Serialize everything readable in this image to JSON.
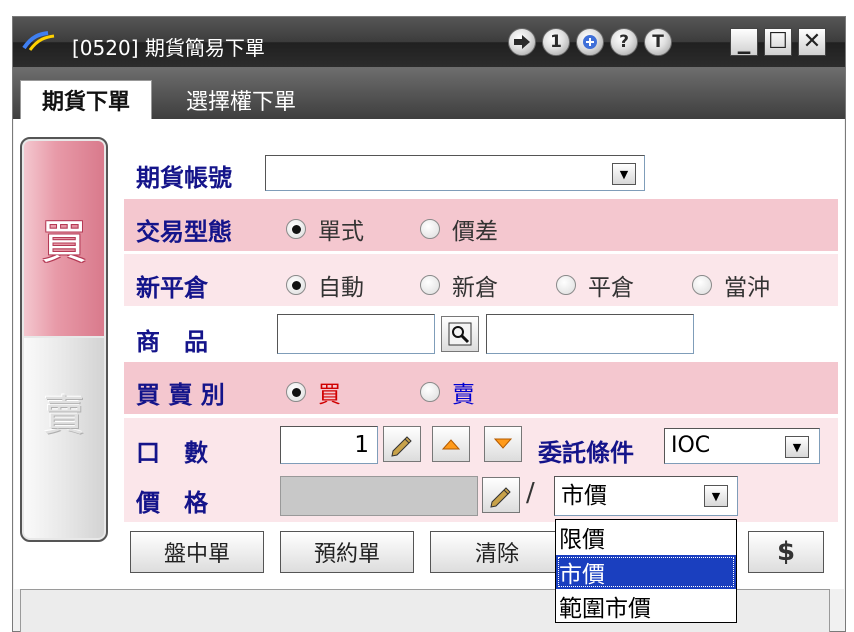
{
  "window": {
    "title": "[0520] 期貨簡易下單",
    "toolbar_icons": [
      "forward-icon",
      "one-icon",
      "settings-icon",
      "help-icon",
      "t-icon"
    ],
    "toolbar_labels": [
      "1",
      "?",
      "T"
    ],
    "minimize": "▁",
    "maximize": "☐",
    "close": "✕"
  },
  "tabs": [
    {
      "label": "期貨下單",
      "active": true
    },
    {
      "label": "選擇權下單",
      "active": false
    }
  ],
  "side": {
    "buy": "買",
    "sell": "賣",
    "selected": "buy"
  },
  "form": {
    "account": {
      "label": "期貨帳號",
      "value": ""
    },
    "trade_type": {
      "label": "交易型態",
      "options": [
        "單式",
        "價差"
      ],
      "selected": 0
    },
    "open_close": {
      "label": "新平倉",
      "options": [
        "自動",
        "新倉",
        "平倉",
        "當沖"
      ],
      "selected": 0
    },
    "product": {
      "label": "商　品",
      "code": "",
      "name": ""
    },
    "bs": {
      "label": "買 賣 別",
      "options": [
        "買",
        "賣"
      ],
      "selected": 0,
      "colors": [
        "#d00000",
        "#0000d0"
      ]
    },
    "qty": {
      "label": "口　數",
      "value": "1"
    },
    "condition": {
      "label": "委託條件",
      "value": "IOC"
    },
    "price": {
      "label": "價　格",
      "value": "",
      "slash": "/",
      "type": "市價",
      "type_options": [
        "限價",
        "市價",
        "範圍市價"
      ],
      "type_selected": 1
    }
  },
  "buttons": {
    "intraday": "盤中單",
    "reserve": "預約單",
    "clear": "清除",
    "dollar": "$"
  },
  "colors": {
    "label": "#14148a",
    "row_dark": "#f4c7cf",
    "row_light": "#fbe6ea",
    "highlight": "#1a3fbf"
  }
}
